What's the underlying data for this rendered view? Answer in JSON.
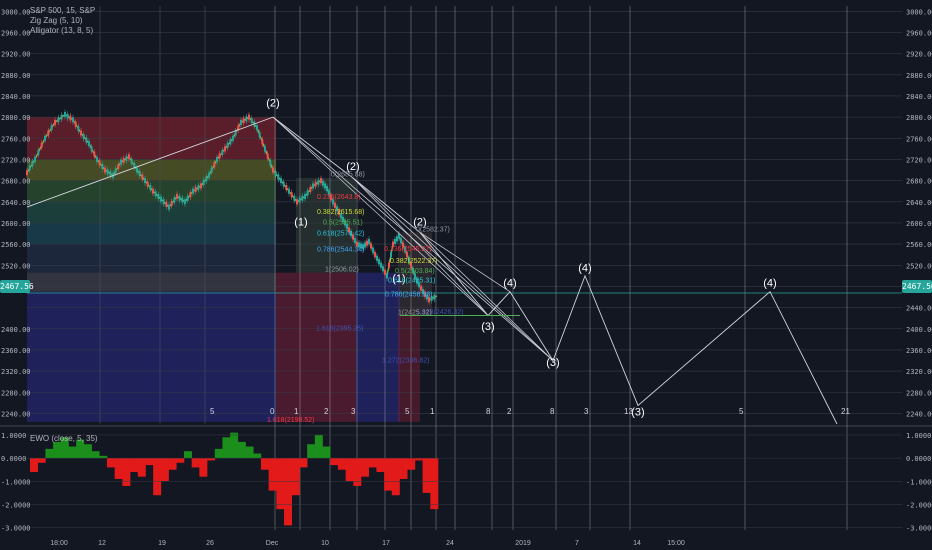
{
  "header": {
    "symbol_line": "S&P 500, 15, S&P",
    "zigzag_label": "Zig Zag (5, 10)",
    "alligator_label": "Alligator (13, 8, 5)",
    "ewo_label": "EWO (close, 5, 35)"
  },
  "price_badge": "2467.56",
  "chart_data": {
    "type": "line",
    "main": {
      "ylim": [
        2220,
        3010
      ],
      "yticks": [
        "3000.00",
        "2960.00",
        "2920.00",
        "2880.00",
        "2840.00",
        "2800.00",
        "2760.00",
        "2720.00",
        "2680.00",
        "2640.00",
        "2600.00",
        "2560.00",
        "2520.00",
        "2480.00",
        "2440.00",
        "2400.00",
        "2360.00",
        "2320.00",
        "2280.00",
        "2240.00"
      ],
      "yticks_left": [
        "3000.00",
        "2960.00",
        "2920.00",
        "2880.00",
        "2840.00",
        "2800.00",
        "2760.00",
        "2720.00",
        "2680.00",
        "2640.00",
        "2600.00",
        "2560.00",
        "2520.00",
        "2480.00",
        "2400.00",
        "2360.00",
        "2320.00",
        "2280.00",
        "2240.00"
      ],
      "current_price": 2467.56,
      "price_path": [
        [
          0,
          2695
        ],
        [
          8,
          2720
        ],
        [
          18,
          2760
        ],
        [
          28,
          2790
        ],
        [
          38,
          2805
        ],
        [
          46,
          2795
        ],
        [
          54,
          2770
        ],
        [
          62,
          2750
        ],
        [
          70,
          2720
        ],
        [
          78,
          2700
        ],
        [
          86,
          2690
        ],
        [
          94,
          2715
        ],
        [
          102,
          2725
        ],
        [
          110,
          2700
        ],
        [
          118,
          2680
        ],
        [
          126,
          2660
        ],
        [
          134,
          2645
        ],
        [
          142,
          2630
        ],
        [
          150,
          2650
        ],
        [
          158,
          2640
        ],
        [
          166,
          2660
        ],
        [
          174,
          2670
        ],
        [
          182,
          2690
        ],
        [
          190,
          2720
        ],
        [
          198,
          2740
        ],
        [
          206,
          2760
        ],
        [
          214,
          2790
        ],
        [
          222,
          2800
        ],
        [
          230,
          2780
        ],
        [
          238,
          2740
        ],
        [
          246,
          2700
        ],
        [
          254,
          2680
        ],
        [
          262,
          2660
        ],
        [
          270,
          2640
        ],
        [
          278,
          2650
        ],
        [
          286,
          2670
        ],
        [
          294,
          2680
        ],
        [
          300,
          2665
        ],
        [
          306,
          2640
        ],
        [
          312,
          2620
        ],
        [
          318,
          2600
        ],
        [
          324,
          2580
        ],
        [
          330,
          2560
        ],
        [
          336,
          2555
        ],
        [
          342,
          2565
        ],
        [
          348,
          2540
        ],
        [
          354,
          2520
        ],
        [
          360,
          2500
        ],
        [
          366,
          2560
        ],
        [
          372,
          2575
        ],
        [
          378,
          2550
        ],
        [
          384,
          2520
        ],
        [
          390,
          2490
        ],
        [
          396,
          2470
        ],
        [
          402,
          2455
        ],
        [
          410,
          2462
        ]
      ],
      "wave_labels": [
        {
          "text": "(2)",
          "x": 246,
          "y": 2820
        },
        {
          "text": "(2)",
          "x": 326,
          "y": 2700
        },
        {
          "text": "(2)",
          "x": 393,
          "y": 2595
        },
        {
          "text": "(1)",
          "x": 274,
          "y": 2595
        },
        {
          "text": "(1)",
          "x": 372,
          "y": 2488
        },
        {
          "text": "(3)",
          "x": 461,
          "y": 2398
        },
        {
          "text": "(3)",
          "x": 526,
          "y": 2330
        },
        {
          "text": "(3)",
          "x": 611,
          "y": 2236
        },
        {
          "text": "(4)",
          "x": 483,
          "y": 2480
        },
        {
          "text": "(4)",
          "x": 558,
          "y": 2508
        },
        {
          "text": "(4)",
          "x": 743,
          "y": 2480
        }
      ],
      "fib_levels": [
        {
          "text": "0(2685.88)",
          "x": 304,
          "y": 2688,
          "color": "#9598a1"
        },
        {
          "text": "0.236(2643.8)",
          "x": 290,
          "y": 2645,
          "color": "#f23645"
        },
        {
          "text": "0.382(2615.68)",
          "x": 290,
          "y": 2617,
          "color": "#cddc39"
        },
        {
          "text": "0.5(2595.51)",
          "x": 296,
          "y": 2597,
          "color": "#4caf50"
        },
        {
          "text": "0.618(2574.42)",
          "x": 290,
          "y": 2576,
          "color": "#26c6da"
        },
        {
          "text": "0.786(2544.34)",
          "x": 290,
          "y": 2546,
          "color": "#42a5f5"
        },
        {
          "text": "1(2506.02)",
          "x": 298,
          "y": 2508,
          "color": "#9598a1"
        },
        {
          "text": "1.618(2395.25)",
          "x": 289,
          "y": 2397,
          "color": "#3f51b5"
        },
        {
          "text": "1.618(2426.32)",
          "x": 389,
          "y": 2428,
          "color": "#3f51b5"
        },
        {
          "text": "0(2582.37)",
          "x": 389,
          "y": 2584,
          "color": "#9598a1"
        },
        {
          "text": "0.236(2545.27)",
          "x": 357,
          "y": 2547,
          "color": "#f23645"
        },
        {
          "text": "0.382(2522.37)",
          "x": 363,
          "y": 2524,
          "color": "#cddc39"
        },
        {
          "text": "0.5(2503.84)",
          "x": 368,
          "y": 2505,
          "color": "#4caf50"
        },
        {
          "text": "0.618(2485.31)",
          "x": 361,
          "y": 2487,
          "color": "#26c6da"
        },
        {
          "text": "0.786(2458.93)",
          "x": 358,
          "y": 2461,
          "color": "#42a5f5"
        },
        {
          "text": "1(2425.32)",
          "x": 371,
          "y": 2427,
          "color": "#9598a1"
        },
        {
          "text": "1.272(2336.82)",
          "x": 355,
          "y": 2336,
          "color": "#3f51b5"
        },
        {
          "text": "1.618(2198.52)",
          "x": 240,
          "y": 2224,
          "color": "#f23645"
        }
      ],
      "cycle_numbers": [
        {
          "text": "5",
          "x": 216
        },
        {
          "text": "0",
          "x": 276
        },
        {
          "text": "1",
          "x": 300
        },
        {
          "text": "2",
          "x": 330
        },
        {
          "text": "3",
          "x": 357
        },
        {
          "text": "5",
          "x": 411
        },
        {
          "text": "1",
          "x": 436
        },
        {
          "text": "8",
          "x": 492
        },
        {
          "text": "2",
          "x": 513
        },
        {
          "text": "8",
          "x": 556
        },
        {
          "text": "3",
          "x": 590
        },
        {
          "text": "13",
          "x": 630
        },
        {
          "text": "5",
          "x": 745
        },
        {
          "text": "21",
          "x": 847
        }
      ]
    },
    "ewo": {
      "ylim": [
        -3.1,
        1.3
      ],
      "yticks": [
        "1.0000",
        "0.0000",
        "-1.0000",
        "-2.0000",
        "-3.0000"
      ],
      "yticks_left": [
        "1.0000",
        "0.0000",
        "-1.0000",
        "-2.0000",
        "-3.0000"
      ],
      "values": [
        -0.6,
        -0.2,
        0.4,
        0.7,
        0.9,
        0.5,
        0.8,
        0.6,
        0.3,
        0.1,
        -0.4,
        -0.9,
        -1.2,
        -0.6,
        -0.8,
        -0.3,
        -1.6,
        -1.0,
        -0.5,
        -0.2,
        0.3,
        -0.4,
        -0.8,
        -0.1,
        0.4,
        0.9,
        1.1,
        0.7,
        0.5,
        0.2,
        -0.5,
        -1.4,
        -2.2,
        -2.9,
        -1.6,
        -0.4,
        0.6,
        1.0,
        0.5,
        -0.3,
        -0.5,
        -1.0,
        -1.2,
        -0.8,
        -0.4,
        -0.6,
        -1.4,
        -1.6,
        -0.9,
        -0.5,
        -0.1,
        -1.5,
        -2.2
      ]
    },
    "x_axis_labels": [
      "18:00",
      "12",
      "19",
      "26",
      "Dec",
      "10",
      "17",
      "24",
      "2019",
      "7",
      "14",
      "15:00"
    ]
  },
  "colors": {
    "bg": "#131722",
    "grid": "#363a45",
    "bull": "#26a69a",
    "bear": "#ef5350",
    "ewo_up": "#1b8e1b",
    "ewo_down": "#e31a1a"
  }
}
